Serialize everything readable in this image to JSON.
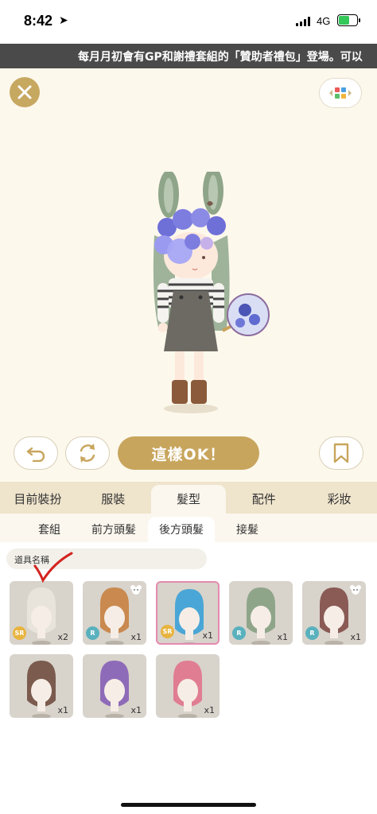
{
  "status_bar": {
    "time": "8:42",
    "network": "4G"
  },
  "marquee": {
    "text": "每月月初會有GP和謝禮套組的「贊助者禮包」登場。可以"
  },
  "stage": {
    "ok_label": "這樣OK！"
  },
  "tabs": [
    {
      "label": "目前裝扮"
    },
    {
      "label": "服裝"
    },
    {
      "label": "髮型"
    },
    {
      "label": "配件"
    },
    {
      "label": "彩妝"
    }
  ],
  "subtabs": [
    {
      "label": "套組"
    },
    {
      "label": "前方頭髮"
    },
    {
      "label": "後方頭髮"
    },
    {
      "label": "接髮"
    }
  ],
  "search": {
    "placeholder": "道具名稱"
  },
  "items": [
    {
      "rarity": "SR",
      "count": "x2",
      "hair_color": "#e8e3db",
      "bear": false,
      "selected": false
    },
    {
      "rarity": "R",
      "count": "x1",
      "hair_color": "#c9894f",
      "bear": true,
      "selected": false
    },
    {
      "rarity": "SR",
      "count": "x1",
      "hair_color": "#4aa6d6",
      "bear": false,
      "selected": true
    },
    {
      "rarity": "R",
      "count": "x1",
      "hair_color": "#8fa58a",
      "bear": false,
      "selected": false
    },
    {
      "rarity": "R",
      "count": "x1",
      "hair_color": "#8a5a55",
      "bear": true,
      "selected": false
    },
    {
      "rarity": "",
      "count": "x1",
      "hair_color": "#7a5b4e",
      "bear": false,
      "selected": false
    },
    {
      "rarity": "",
      "count": "x1",
      "hair_color": "#8e6bb8",
      "bear": false,
      "selected": false
    },
    {
      "rarity": "",
      "count": "x1",
      "hair_color": "#e07d93",
      "bear": false,
      "selected": false
    }
  ]
}
